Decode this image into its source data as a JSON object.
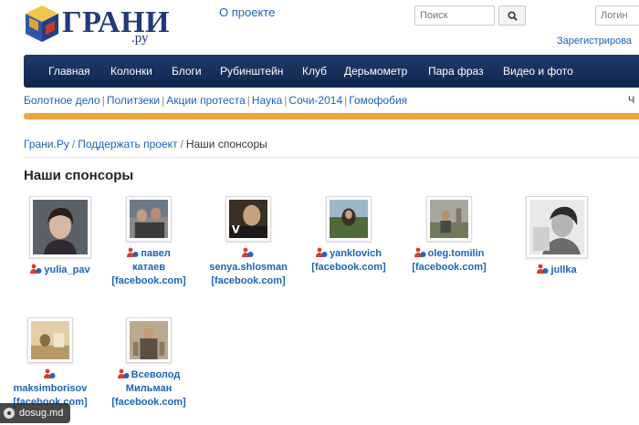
{
  "header": {
    "logo_text": "ГРАНИ",
    "logo_sub": ".ру",
    "about": "О проекте",
    "search_placeholder": "Поиск",
    "login_placeholder": "Логин",
    "register": "Зарегистрирова"
  },
  "nav": [
    "Главная",
    "Колонки",
    "Блоги",
    "Рубинштейн",
    "Клуб",
    "Дерьмометр",
    "Пара фраз",
    "Видео и фото"
  ],
  "topics": {
    "items": [
      "Болотное дело",
      "Политзеки",
      "Акции протеста",
      "Наука",
      "Сочи-2014",
      "Гомофобия"
    ],
    "separator": "|",
    "cut_text": "Ч"
  },
  "breadcrumb": {
    "items": [
      "Грани.Ру",
      "Поддержать проект"
    ],
    "current": "Наши спонсоры",
    "separator": "/"
  },
  "page_title": "Наши спонсоры",
  "sponsors": [
    {
      "lines": [
        "yulia_pav"
      ]
    },
    {
      "lines": [
        "павел",
        "катаев",
        "[facebook.com]"
      ]
    },
    {
      "lines": [
        "senya.shlosman",
        "[facebook.com]"
      ]
    },
    {
      "lines": [
        "yanklovich",
        "[facebook.com]"
      ]
    },
    {
      "lines": [
        "oleg.tomilin",
        "[facebook.com]"
      ]
    },
    {
      "lines": [
        "jullka"
      ]
    },
    {
      "lines": [
        "maksimborisov",
        "[facebook.com]"
      ]
    },
    {
      "lines": [
        "Всеволод",
        "Мильман",
        "[facebook.com]"
      ]
    }
  ],
  "watermark": "dosug.md",
  "colors": {
    "nav_bg": "#1a325f",
    "link": "#1a63b8",
    "accent_bar": "#f2a43a",
    "logo": "#233a7a"
  },
  "icons": {
    "search": "magnifier-icon",
    "user": "user-icon"
  }
}
